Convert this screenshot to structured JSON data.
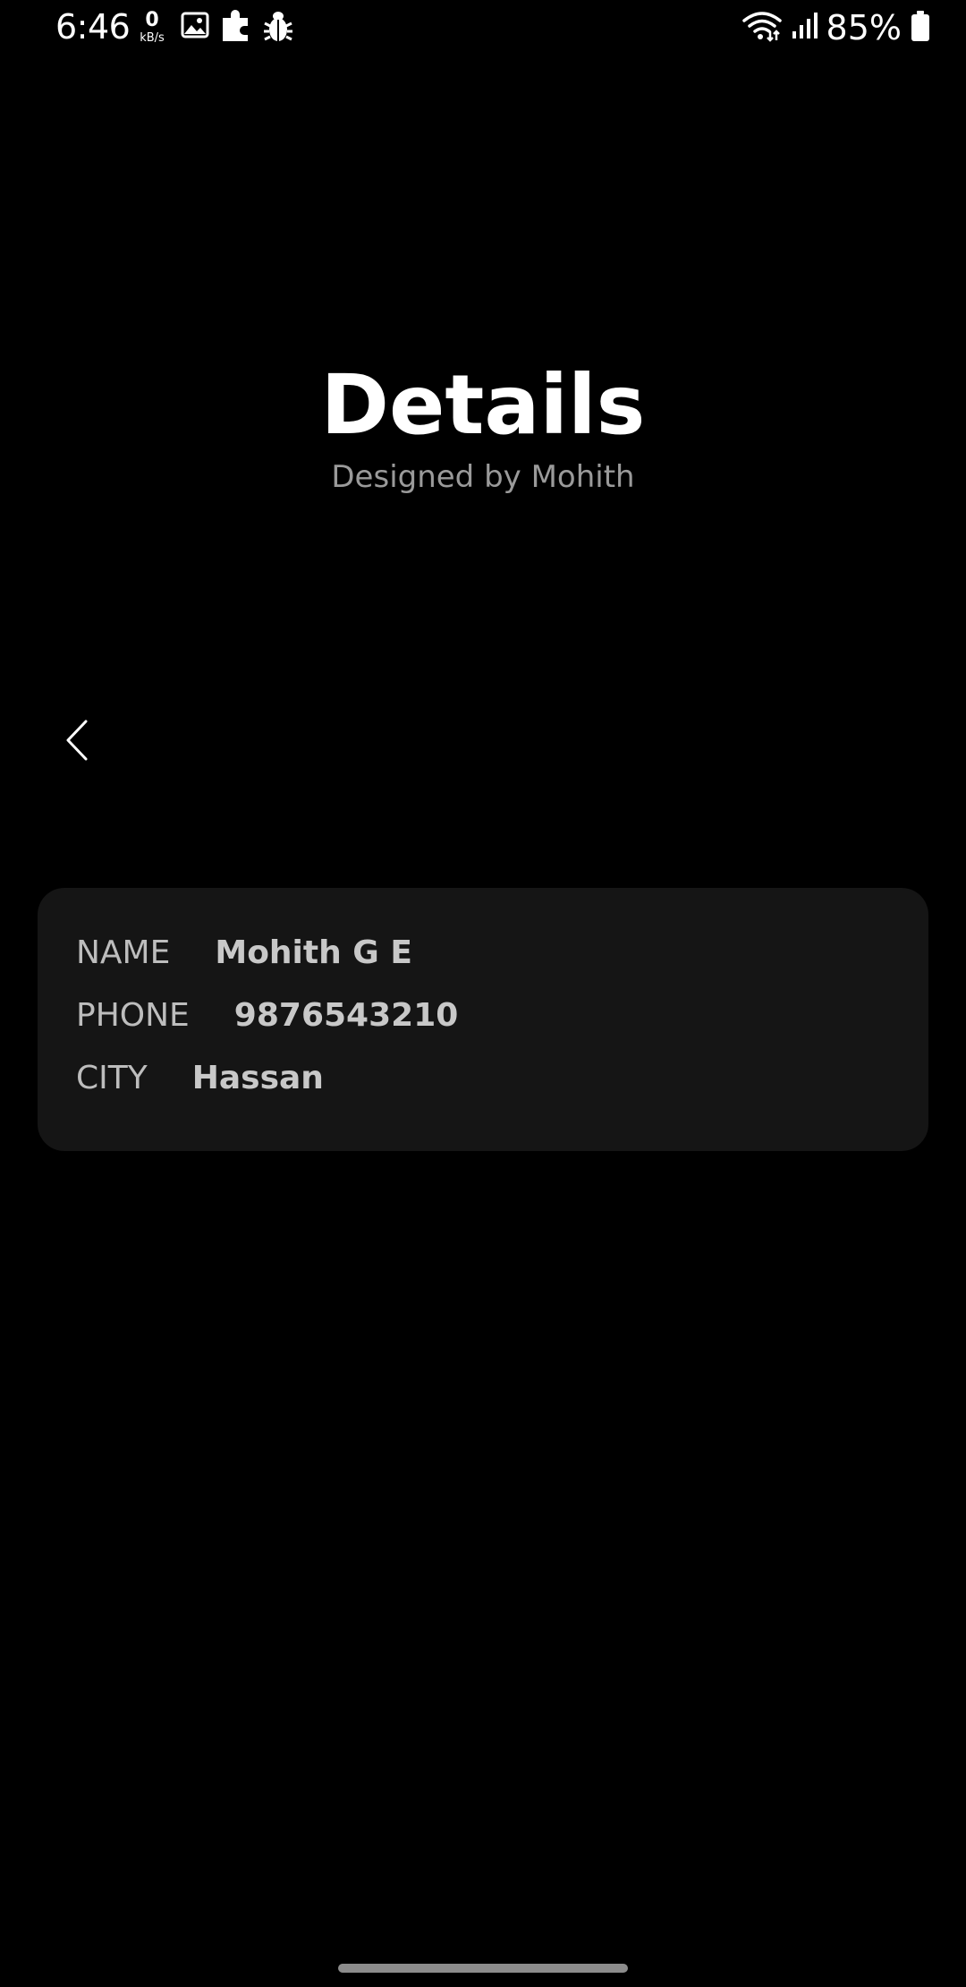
{
  "status_bar": {
    "time": "6:46",
    "net_speed_value": "0",
    "net_speed_unit": "kB/s",
    "battery_percent": "85%",
    "icons": [
      "image-icon",
      "puzzle-icon",
      "bug-icon",
      "wifi-icon",
      "signal-icon",
      "battery-icon"
    ]
  },
  "header": {
    "title": "Details",
    "subtitle": "Designed by Mohith"
  },
  "navigation": {
    "back_icon": "chevron-left-icon"
  },
  "details": {
    "rows": [
      {
        "label": "NAME",
        "value": "Mohith G E"
      },
      {
        "label": "PHONE",
        "value": "9876543210"
      },
      {
        "label": "CITY",
        "value": "Hassan"
      }
    ]
  },
  "colors": {
    "background": "#000000",
    "card": "#151515",
    "title": "#ffffff",
    "subtitle": "#9a9a9a",
    "label": "#bdbdbd",
    "value": "#c8c8c8"
  }
}
